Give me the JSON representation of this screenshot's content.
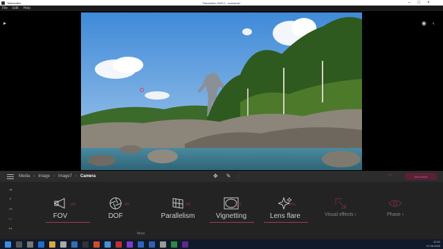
{
  "window": {
    "app_name": "Twinmotion",
    "title": "Twinmotion 2020.1 - koncerne*"
  },
  "menu": [
    "File",
    "Edit",
    "Help"
  ],
  "breadcrumb": [
    "Media",
    "Image",
    "Image7",
    "Camera"
  ],
  "add_button": "Add media",
  "features": [
    {
      "label": "FOV",
      "percent": "0%",
      "icon": "fov-icon",
      "active": true
    },
    {
      "label": "DOF",
      "percent": "0%",
      "icon": "aperture-icon",
      "active": false
    },
    {
      "label": "Parallelism",
      "percent": "0%",
      "icon": "grid-icon",
      "active": false
    },
    {
      "label": "Vignetting",
      "percent": "40%",
      "icon": "vignette-icon",
      "active": true
    },
    {
      "label": "Lens flare",
      "percent": "40%",
      "icon": "sparkle-icon",
      "active": true
    }
  ],
  "secondary": [
    {
      "label": "Visual effects",
      "icon": "cursor-icon"
    },
    {
      "label": "Phase",
      "icon": "eye-icon"
    }
  ],
  "more_label": "More",
  "clock": {
    "time": "22:02",
    "date": "07.05.2020"
  },
  "colors": {
    "accent": "#a53a5c",
    "panel": "#232323",
    "bar": "#2c2c2c"
  }
}
